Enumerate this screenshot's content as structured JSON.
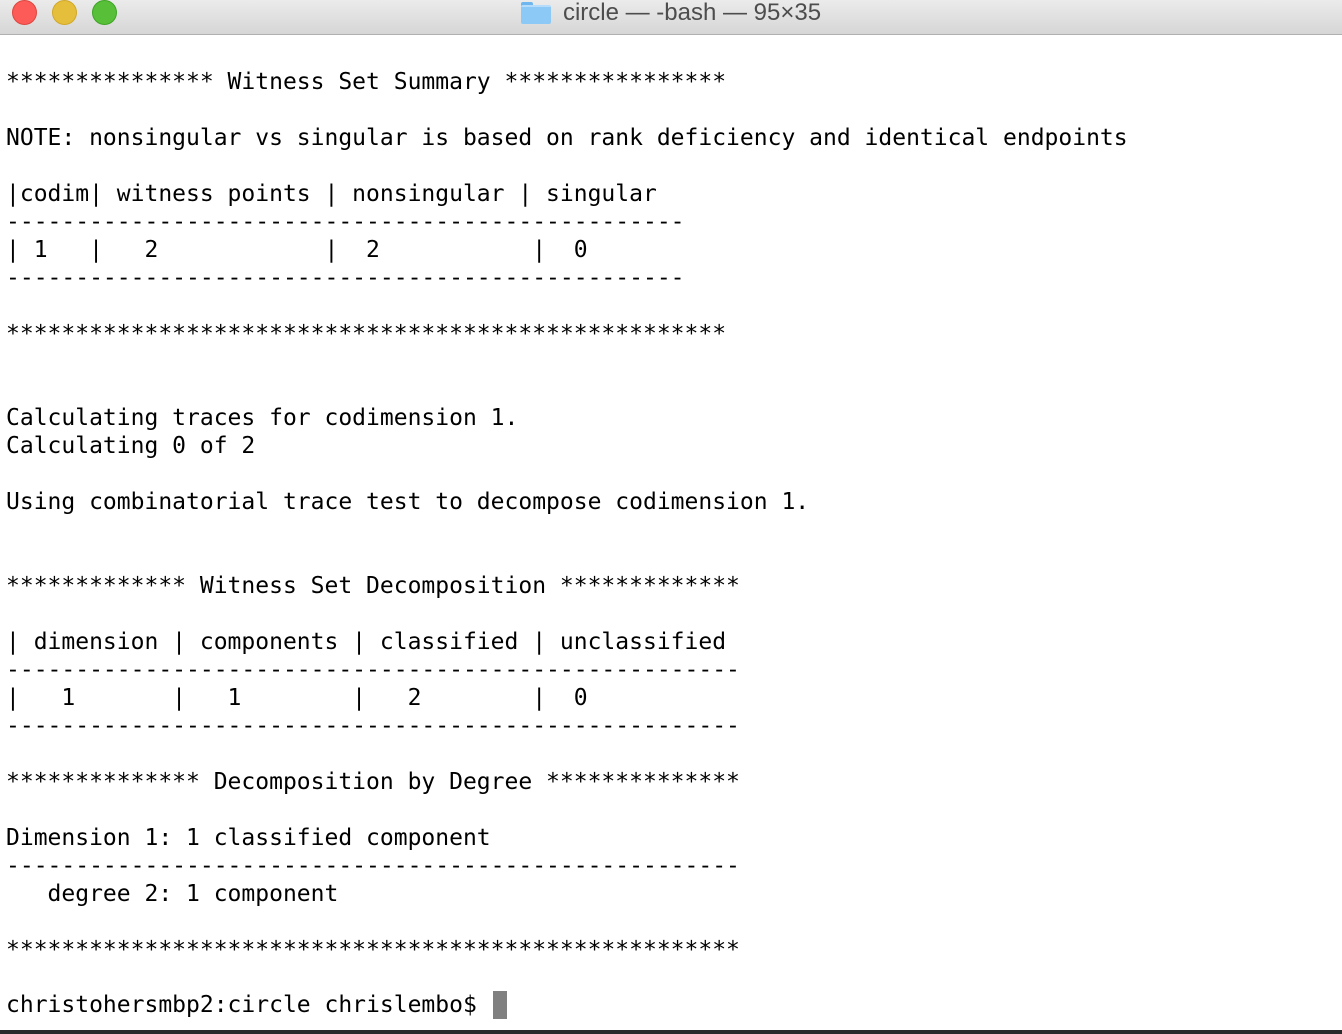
{
  "window": {
    "title": "circle — -bash — 95×35",
    "folder_icon": "folder-icon"
  },
  "terminal": {
    "lines": [
      "*************** Witness Set Summary ****************",
      "NOTE: nonsingular vs singular is based on rank deficiency and identical endpoints",
      "|codim| witness points | nonsingular | singular",
      "-------------------------------------------------",
      "| 1   |   2            |  2           |  0",
      "-------------------------------------------------",
      "****************************************************",
      "Calculating traces for codimension 1.",
      "Calculating 0 of 2",
      "Using combinatorial trace test to decompose codimension 1.",
      "************* Witness Set Decomposition *************",
      "| dimension | components | classified | unclassified",
      "-----------------------------------------------------",
      "|   1       |   1        |   2        |  0",
      "-----------------------------------------------------",
      "************** Decomposition by Degree **************",
      "Dimension 1: 1 classified component",
      "-----------------------------------------------------",
      "   degree 2: 1 component",
      "*****************************************************"
    ],
    "prompt": "christohersmbp2:circle chrislembo$ "
  }
}
